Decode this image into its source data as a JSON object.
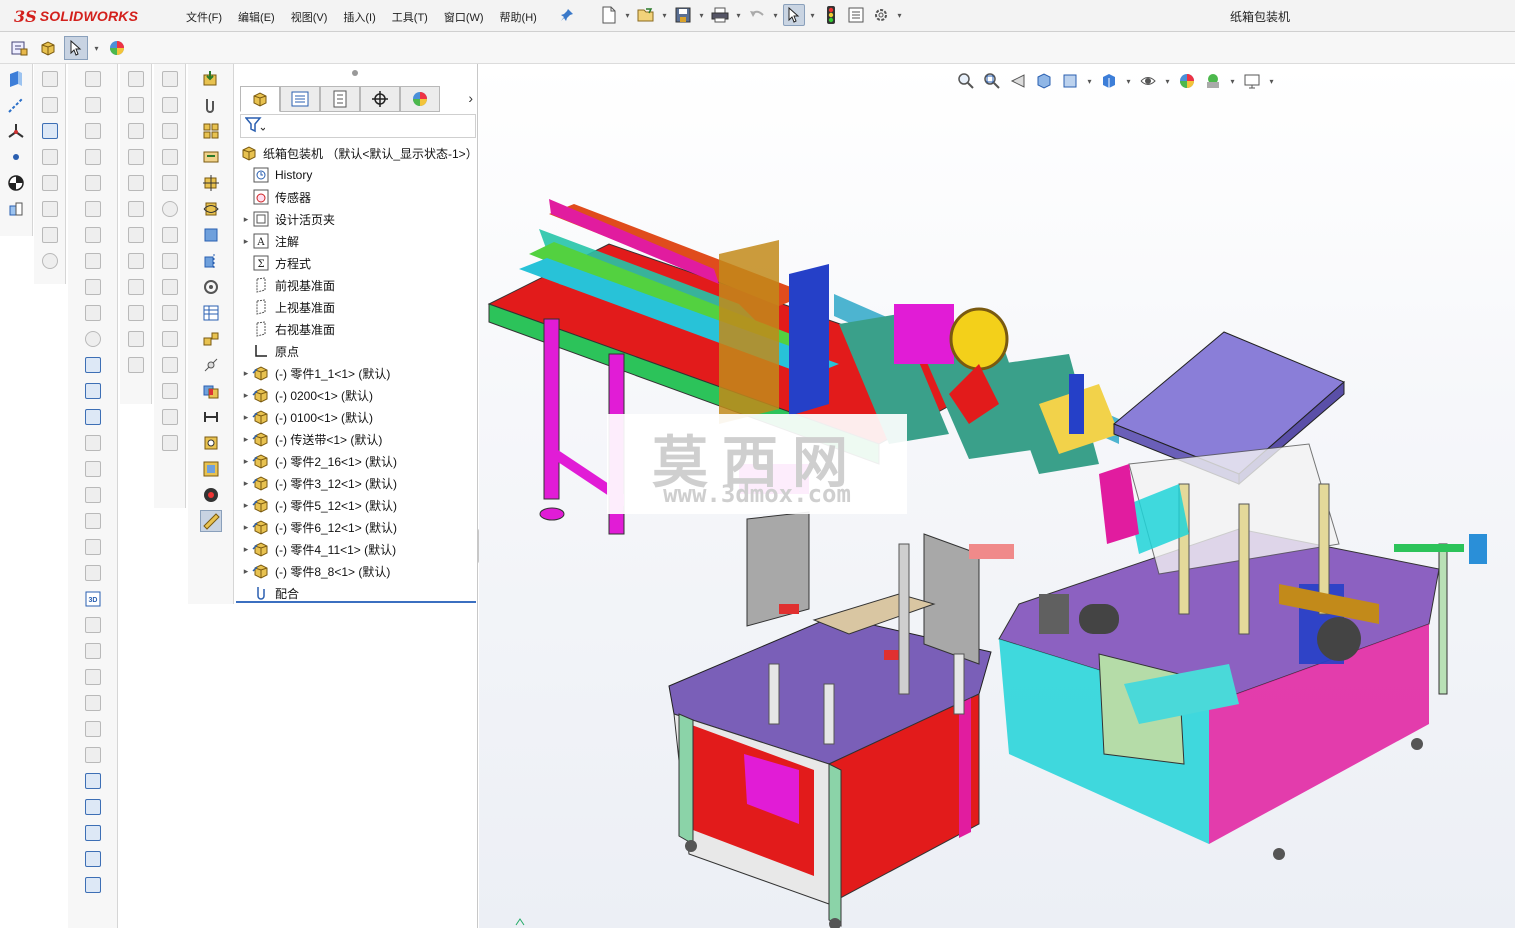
{
  "app": {
    "logo_ds": "3S",
    "logo_name": "SOLIDWORKS",
    "document_title": "纸箱包装机"
  },
  "menu": [
    {
      "label": "文件(F)"
    },
    {
      "label": "编辑(E)"
    },
    {
      "label": "视图(V)"
    },
    {
      "label": "插入(I)"
    },
    {
      "label": "工具(T)"
    },
    {
      "label": "窗口(W)"
    },
    {
      "label": "帮助(H)"
    }
  ],
  "feature_tree": {
    "root": "纸箱包装机 （默认<默认_显示状态-1>）",
    "items": [
      {
        "label": "History",
        "icon": "history-icon",
        "expandable": false
      },
      {
        "label": "传感器",
        "icon": "sensor-icon",
        "expandable": false
      },
      {
        "label": "设计活页夹",
        "icon": "design-binder-icon",
        "expandable": true
      },
      {
        "label": "注解",
        "icon": "annotation-icon",
        "expandable": true
      },
      {
        "label": "方程式",
        "icon": "equation-icon",
        "expandable": false
      },
      {
        "label": "前视基准面",
        "icon": "plane-icon",
        "expandable": false
      },
      {
        "label": "上视基准面",
        "icon": "plane-icon",
        "expandable": false
      },
      {
        "label": "右视基准面",
        "icon": "plane-icon",
        "expandable": false
      },
      {
        "label": "原点",
        "icon": "origin-icon",
        "expandable": false
      },
      {
        "label": "(-) 零件1_1<1> (默认)",
        "icon": "subassembly-icon",
        "expandable": true
      },
      {
        "label": "(-) 0200<1> (默认)",
        "icon": "subassembly-icon",
        "expandable": true
      },
      {
        "label": "(-) 0100<1> (默认)",
        "icon": "subassembly-icon",
        "expandable": true
      },
      {
        "label": "(-) 传送带<1> (默认)",
        "icon": "subassembly-icon",
        "expandable": true
      },
      {
        "label": "(-) 零件2_16<1> (默认)",
        "icon": "subassembly-icon",
        "expandable": true
      },
      {
        "label": "(-) 零件3_12<1> (默认)",
        "icon": "subassembly-icon",
        "expandable": true
      },
      {
        "label": "(-) 零件5_12<1> (默认)",
        "icon": "subassembly-icon",
        "expandable": true
      },
      {
        "label": "(-) 零件6_12<1> (默认)",
        "icon": "subassembly-icon",
        "expandable": true
      },
      {
        "label": "(-) 零件4_11<1> (默认)",
        "icon": "subassembly-icon",
        "expandable": true
      },
      {
        "label": "(-) 零件8_8<1> (默认)",
        "icon": "subassembly-icon",
        "expandable": true
      },
      {
        "label": "配合",
        "icon": "mates-icon",
        "expandable": false
      }
    ]
  },
  "watermark": {
    "chinese": "莫西网",
    "url": "www.3dmox.com"
  },
  "colors": {
    "brand_red": "#d3201c",
    "selection_blue": "#3b6fc0"
  }
}
